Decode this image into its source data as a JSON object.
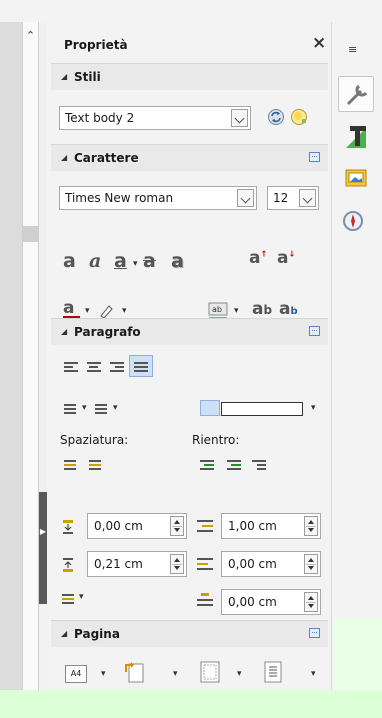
{
  "panel": {
    "title": "Proprietà",
    "close": "×"
  },
  "stili": {
    "header": "Stili",
    "style_value": "Text body 2"
  },
  "carattere": {
    "header": "Carattere",
    "font_name": "Times New roman",
    "font_size": "12"
  },
  "paragrafo": {
    "header": "Paragrafo",
    "spaziatura_label": "Spaziatura:",
    "rientro_label": "Rientro:",
    "above_spacing": "0,00 cm",
    "below_spacing": "0,21 cm",
    "indent_before": "1,00 cm",
    "indent_after": "0,00 cm",
    "first_line_indent": "0,00 cm"
  },
  "pagina": {
    "header": "Pagina",
    "page_size_icon_label": "A4"
  },
  "colors": {
    "font_color": "#c00000",
    "highlight_color": "#ffff00",
    "accent_blue": "#5b84c4",
    "bottom_green": "#dcffd8"
  }
}
